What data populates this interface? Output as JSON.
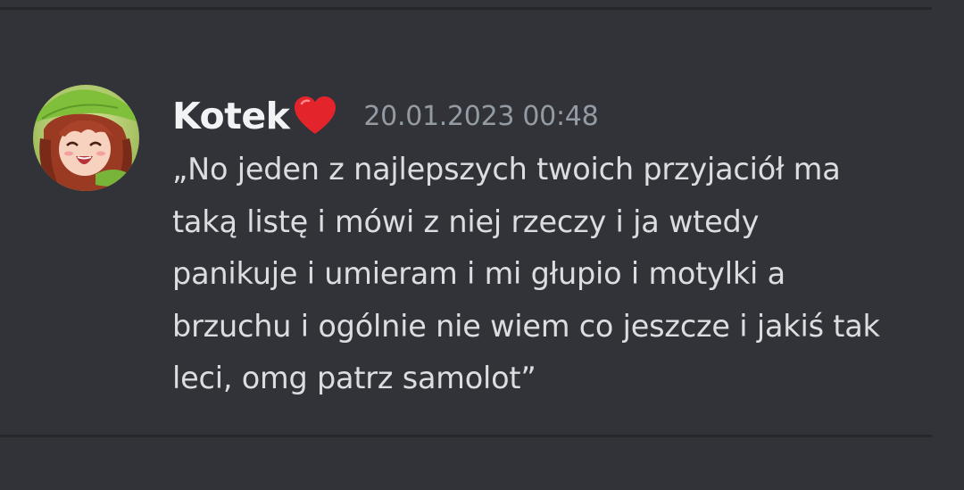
{
  "message": {
    "author": "Kotek",
    "author_icon": "heart-emoji-icon",
    "timestamp": "20.01.2023 00:48",
    "lines": [
      "„No jeden z najlepszych twoich przyjaciół ma",
      "taką listę i mówi z niej rzeczy i ja wtedy",
      "panikuje i umieram i mi głupio i motylki a",
      "brzuchu i ogólnie nie wiem co jeszcze i jakiś tak",
      "leci, omg patrz samolot”"
    ]
  },
  "colors": {
    "background": "#313338",
    "divider": "#26272b",
    "author": "#f2f3f5",
    "timestamp": "#949ba4",
    "text": "#dbdee1",
    "heart": "#e3242b"
  }
}
